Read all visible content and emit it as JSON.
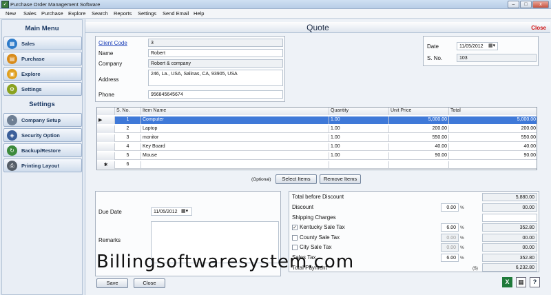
{
  "window": {
    "title": "Purchase Order Management Software",
    "minimize": "–",
    "maximize": "□",
    "close": "x"
  },
  "menu": [
    "New",
    "Sales",
    "Purchase",
    "Explore",
    "Search",
    "Reports",
    "Settings",
    "Send Email",
    "Help"
  ],
  "sidebar": {
    "main_heading": "Main Menu",
    "main_items": [
      {
        "label": "Sales",
        "icon": "sales-icon"
      },
      {
        "label": "Purchase",
        "icon": "purchase-icon"
      },
      {
        "label": "Explore",
        "icon": "explore-icon"
      },
      {
        "label": "Settings",
        "icon": "settings-icon"
      }
    ],
    "settings_heading": "Settings",
    "settings_items": [
      {
        "label": "Company Setup",
        "icon": "company-setup-icon"
      },
      {
        "label": "Security Option",
        "icon": "security-icon"
      },
      {
        "label": "Backup/Restore",
        "icon": "backup-icon"
      },
      {
        "label": "Printing Layout",
        "icon": "printer-icon"
      }
    ]
  },
  "quote": {
    "title": "Quote",
    "close_label": "Close"
  },
  "client": {
    "code_label": "Client Code",
    "code": "3",
    "name_label": "Name",
    "name": "Robert",
    "company_label": "Company",
    "company": "Robert & company",
    "address_label": "Address",
    "address": "246, La., USA, Salinas, CA, 93905, USA",
    "phone_label": "Phone",
    "phone": "956845645674"
  },
  "date_panel": {
    "date_label": "Date",
    "date": "11/05/2012",
    "sno_label": "S. No.",
    "sno": "103"
  },
  "items_table": {
    "columns": [
      "S. No.",
      "Item Name",
      "Quantity",
      "Unit Price",
      "Total"
    ],
    "rows": [
      {
        "sno": "1",
        "item": "Computer",
        "qty": "1.00",
        "price": "5,000.00",
        "total": "5,000.00"
      },
      {
        "sno": "2",
        "item": "Laptop",
        "qty": "1.00",
        "price": "200.00",
        "total": "200.00"
      },
      {
        "sno": "3",
        "item": "monitor",
        "qty": "1.00",
        "price": "550.00",
        "total": "550.00"
      },
      {
        "sno": "4",
        "item": "Key Board",
        "qty": "1.00",
        "price": "40.00",
        "total": "40.00"
      },
      {
        "sno": "5",
        "item": "Mouse",
        "qty": "1.00",
        "price": "90.00",
        "total": "90.00"
      },
      {
        "sno": "6",
        "item": "",
        "qty": "",
        "price": "",
        "total": ""
      }
    ],
    "current_marker": "▶",
    "new_row_marker": "✱"
  },
  "item_actions": {
    "optional_label": "(Optional)",
    "select_items": "Select Items",
    "remove_items": "Remove Items"
  },
  "due": {
    "due_date_label": "Due Date",
    "due_date": "11/05/2012",
    "remarks_label": "Remarks",
    "remarks": ""
  },
  "totals": {
    "total_before_discount_label": "Total before Discount",
    "total_before_discount": "5,880.00",
    "discount_label": "Discount",
    "discount_pct": "0.00",
    "discount_amt": "00.00",
    "shipping_label": "Shipping Charges",
    "shipping": "",
    "kentucky_label": "Kentucky Sale Tax",
    "kentucky_checked": true,
    "kentucky_pct": "6.00",
    "kentucky_amt": "352.80",
    "county_label": "County Sale Tax",
    "county_checked": false,
    "county_pct": "0.00",
    "county_amt": "00.00",
    "city_label": "City Sale Tax",
    "city_checked": false,
    "city_pct": "0.00",
    "city_amt": "00.00",
    "sales_tax_label": "Sales Tax",
    "sales_tax_pct": "6.00",
    "sales_tax_amt": "352.80",
    "total_payment_label": "Total Payment",
    "currency": "($)",
    "total_payment": "6,232.80",
    "pct_symbol": "%"
  },
  "footer": {
    "save": "Save",
    "close": "Close",
    "watermark": "Billingsoftwaresystem.com"
  }
}
